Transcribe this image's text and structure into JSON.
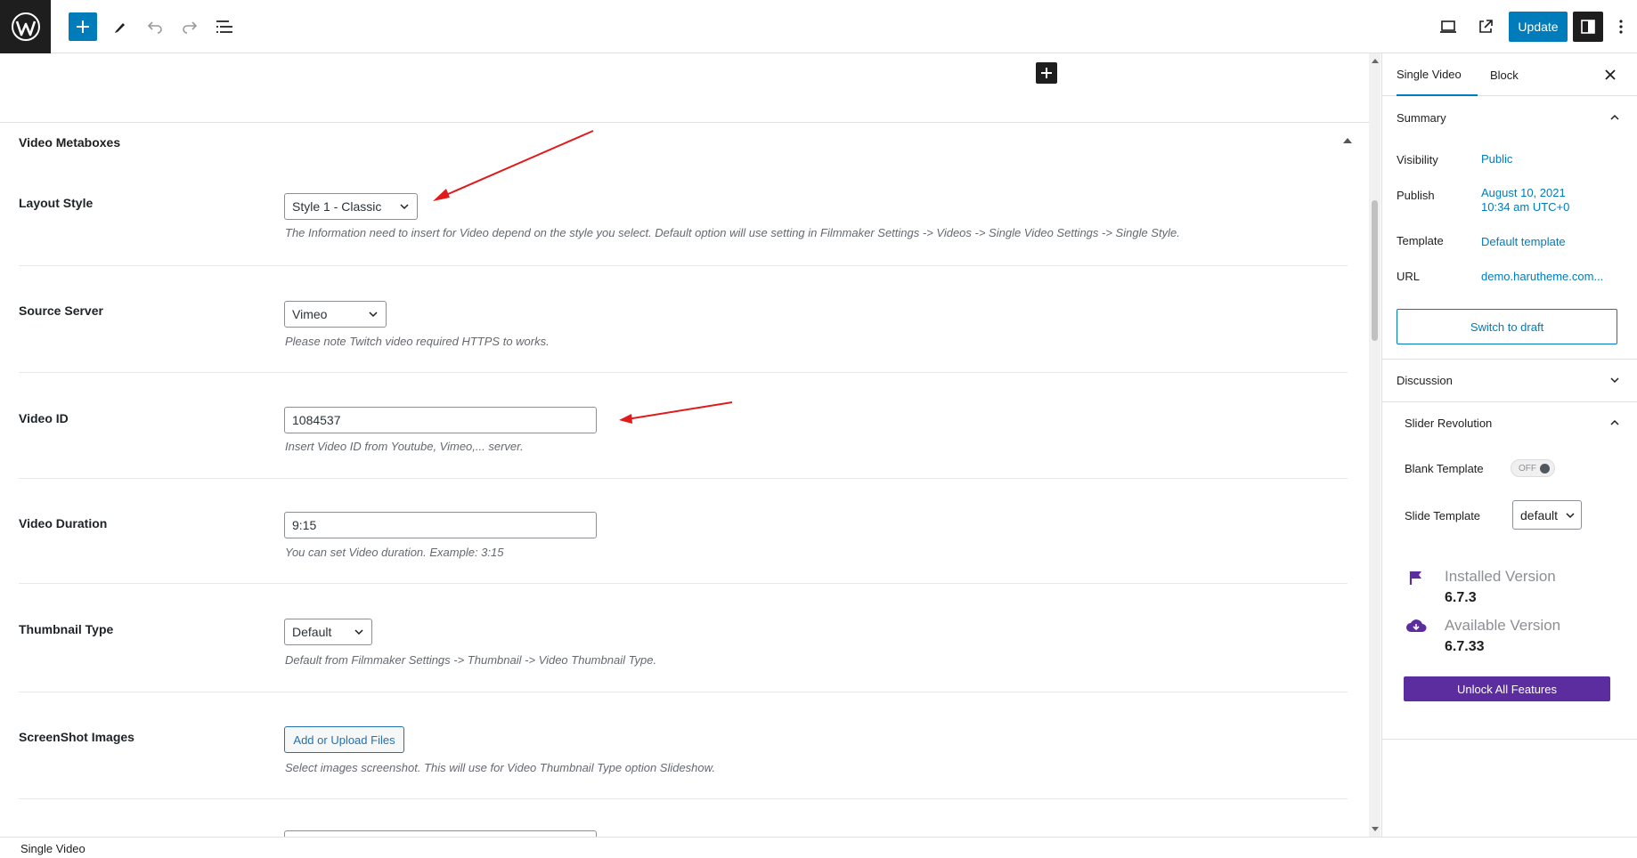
{
  "toolbar": {
    "update_label": "Update"
  },
  "metabox": {
    "title": "Video Metaboxes",
    "fields": {
      "layout_style": {
        "label": "Layout Style",
        "value": "Style 1 - Classic",
        "desc": "The Information need to insert for Video depend on the style you select. Default option will use setting in Filmmaker Settings -> Videos -> Single Video Settings -> Single Style."
      },
      "source_server": {
        "label": "Source Server",
        "value": "Vimeo",
        "desc": "Please note Twitch video required HTTPS to works."
      },
      "video_id": {
        "label": "Video ID",
        "value": "1084537",
        "desc": "Insert Video ID from Youtube, Vimeo,... server."
      },
      "video_duration": {
        "label": "Video Duration",
        "value": "9:15",
        "desc": "You can set Video duration. Example: 3:15"
      },
      "thumbnail_type": {
        "label": "Thumbnail Type",
        "value": "Default",
        "desc": "Default from Filmmaker Settings -> Thumbnail -> Video Thumbnail Type."
      },
      "screenshot_images": {
        "label": "ScreenShot Images",
        "button": "Add or Upload Files",
        "desc": "Select images screenshot. This will use for Video Thumbnail Type option Slideshow."
      }
    }
  },
  "sidebar": {
    "tabs": [
      "Single Video",
      "Block"
    ],
    "summary": {
      "title": "Summary",
      "visibility_label": "Visibility",
      "visibility_value": "Public",
      "publish_label": "Publish",
      "publish_date": "August 10, 2021",
      "publish_time": "10:34 am UTC+0",
      "template_label": "Template",
      "template_value": "Default template",
      "url_label": "URL",
      "url_value": "demo.harutheme.com...",
      "switch_draft": "Switch to draft"
    },
    "discussion": {
      "title": "Discussion"
    },
    "slider_revolution": {
      "title": "Slider Revolution",
      "blank_template_label": "Blank Template",
      "blank_template_toggle": "OFF",
      "slide_template_label": "Slide Template",
      "slide_template_value": "default",
      "installed_label": "Installed Version",
      "installed_version": "6.7.3",
      "available_label": "Available Version",
      "available_version": "6.7.33",
      "unlock_button": "Unlock All Features"
    }
  },
  "footer": {
    "breadcrumb": "Single Video"
  },
  "colors": {
    "accent": "#007cba",
    "dark": "#1e1e1e",
    "annotation_arrow": "#e01b1b",
    "slider_purple": "#5b2d9f"
  }
}
